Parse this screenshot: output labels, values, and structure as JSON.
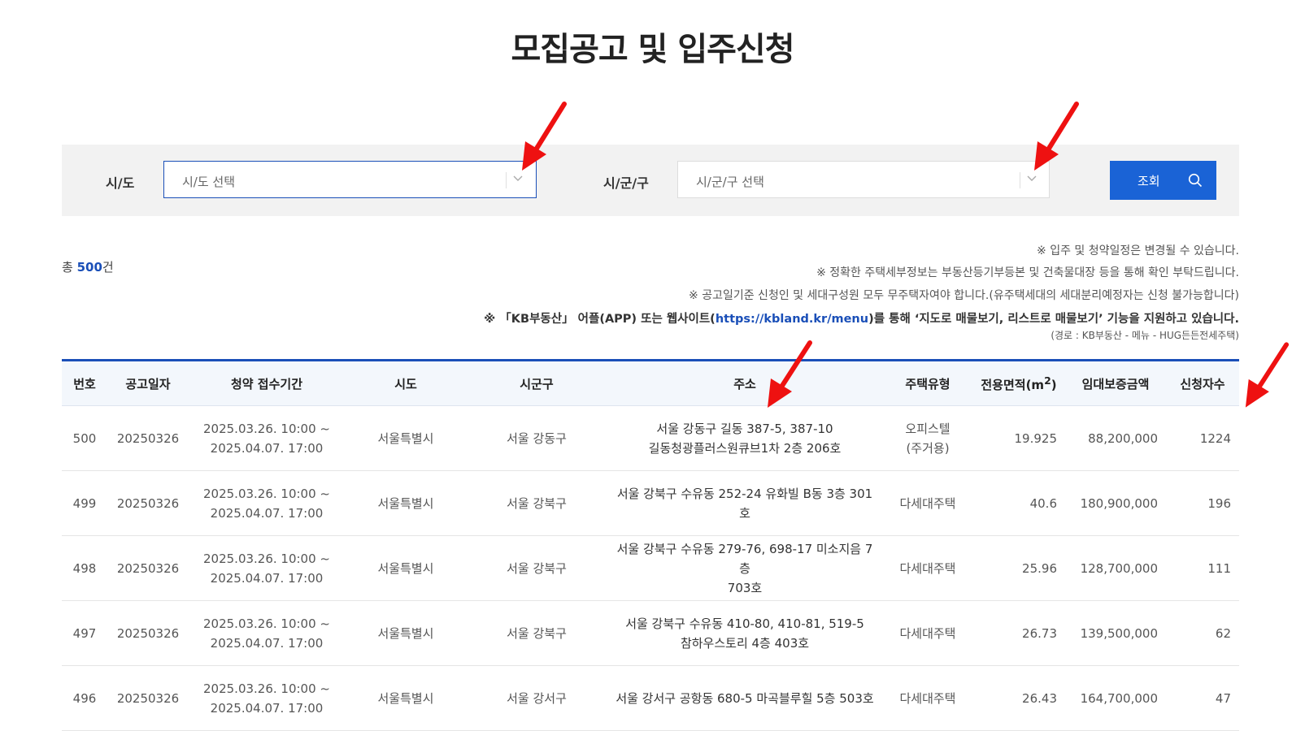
{
  "page": {
    "title": "모집공고 및 입주신청"
  },
  "filters": {
    "sido": {
      "label": "시/도",
      "placeholder": "시/도 선택"
    },
    "sigungu": {
      "label": "시/군/구",
      "placeholder": "시/군/구 선택"
    },
    "search_label": "조회"
  },
  "summary": {
    "prefix": "총 ",
    "count": "500",
    "suffix": "건"
  },
  "notices": [
    "※ 입주 및 청약일정은 변경될 수 있습니다.",
    "※ 정확한 주택세부정보는 부동산등기부등본 및 건축물대장 등을 통해 확인 부탁드립니다.",
    "※ 공고일기준 신청인 및 세대구성원 모두 무주택자여야 합니다.(유주택세대의 세대분리예정자는 신청 불가능합니다)"
  ],
  "kb_notice": {
    "prefix": "※ 「KB부동산」 어플(APP) 또는 웹사이트(",
    "link": "https://kbland.kr/menu",
    "suffix": ")를 통해 ‘지도로 매물보기, 리스트로 매물보기’ 기능을 지원하고 있습니다.",
    "path": "(경로 : KB부동산 - 메뉴 - HUG든든전세주택)"
  },
  "table": {
    "headers": {
      "no": "번호",
      "date": "공고일자",
      "period": "청약 접수기간",
      "sido": "시도",
      "sigungu": "시군구",
      "address": "주소",
      "type": "주택유형",
      "area": "전용면적(m",
      "area_sup": "2",
      "area_close": ")",
      "deposit": "임대보증금액",
      "applicants": "신청자수"
    },
    "rows": [
      {
        "no": "500",
        "date": "20250326",
        "period1": "2025.03.26. 10:00 ~",
        "period2": "2025.04.07. 17:00",
        "sido": "서울특별시",
        "sigungu": "서울 강동구",
        "addr1": "서울 강동구 길동 387-5, 387-10",
        "addr2": "길동청광플러스원큐브1차 2층 206호",
        "type1": "오피스텔",
        "type2": "(주거용)",
        "area": "19.925",
        "deposit": "88,200,000",
        "applicants": "1224"
      },
      {
        "no": "499",
        "date": "20250326",
        "period1": "2025.03.26. 10:00 ~",
        "period2": "2025.04.07. 17:00",
        "sido": "서울특별시",
        "sigungu": "서울 강북구",
        "addr1": "서울 강북구 수유동 252-24 유화빌 B동 3층 301호",
        "addr2": "",
        "type1": "다세대주택",
        "type2": "",
        "area": "40.6",
        "deposit": "180,900,000",
        "applicants": "196"
      },
      {
        "no": "498",
        "date": "20250326",
        "period1": "2025.03.26. 10:00 ~",
        "period2": "2025.04.07. 17:00",
        "sido": "서울특별시",
        "sigungu": "서울 강북구",
        "addr1": "서울 강북구 수유동 279-76, 698-17 미소지음 7층",
        "addr2": "703호",
        "type1": "다세대주택",
        "type2": "",
        "area": "25.96",
        "deposit": "128,700,000",
        "applicants": "111"
      },
      {
        "no": "497",
        "date": "20250326",
        "period1": "2025.03.26. 10:00 ~",
        "period2": "2025.04.07. 17:00",
        "sido": "서울특별시",
        "sigungu": "서울 강북구",
        "addr1": "서울 강북구 수유동 410-80, 410-81, 519-5",
        "addr2": "참하우스토리 4층 403호",
        "type1": "다세대주택",
        "type2": "",
        "area": "26.73",
        "deposit": "139,500,000",
        "applicants": "62"
      },
      {
        "no": "496",
        "date": "20250326",
        "period1": "2025.03.26. 10:00 ~",
        "period2": "2025.04.07. 17:00",
        "sido": "서울특별시",
        "sigungu": "서울 강서구",
        "addr1": "서울 강서구 공항동 680-5 마곡블루힐 5층 503호",
        "addr2": "",
        "type1": "다세대주택",
        "type2": "",
        "area": "26.43",
        "deposit": "164,700,000",
        "applicants": "47"
      }
    ]
  },
  "colors": {
    "primary": "#1a63d6",
    "accent_line": "#1a4fb8",
    "annotation_arrow": "#ee1111"
  },
  "icons": {
    "dropdown": "chevron-down-icon",
    "search": "search-icon",
    "annotation": "red-arrow-icon"
  }
}
